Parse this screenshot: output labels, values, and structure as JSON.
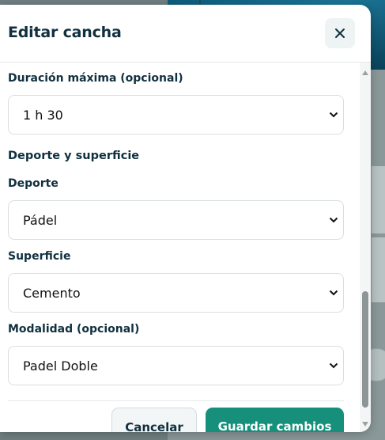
{
  "modal": {
    "title": "Editar cancha",
    "close_icon": "close-icon"
  },
  "fields": {
    "max_duration": {
      "label": "Duración máxima (opcional)",
      "value": "1 h 30"
    },
    "section_title": "Deporte y superficie",
    "sport": {
      "label": "Deporte",
      "value": "Pádel"
    },
    "surface": {
      "label": "Superficie",
      "value": "Cemento"
    },
    "modality": {
      "label": "Modalidad (opcional)",
      "value": "Padel Doble"
    }
  },
  "footer": {
    "cancel_label": "Cancelar",
    "save_label": "Guardar cambios"
  },
  "colors": {
    "primary": "#16907b",
    "heading": "#10303f",
    "overlay": "#6f7f80"
  }
}
